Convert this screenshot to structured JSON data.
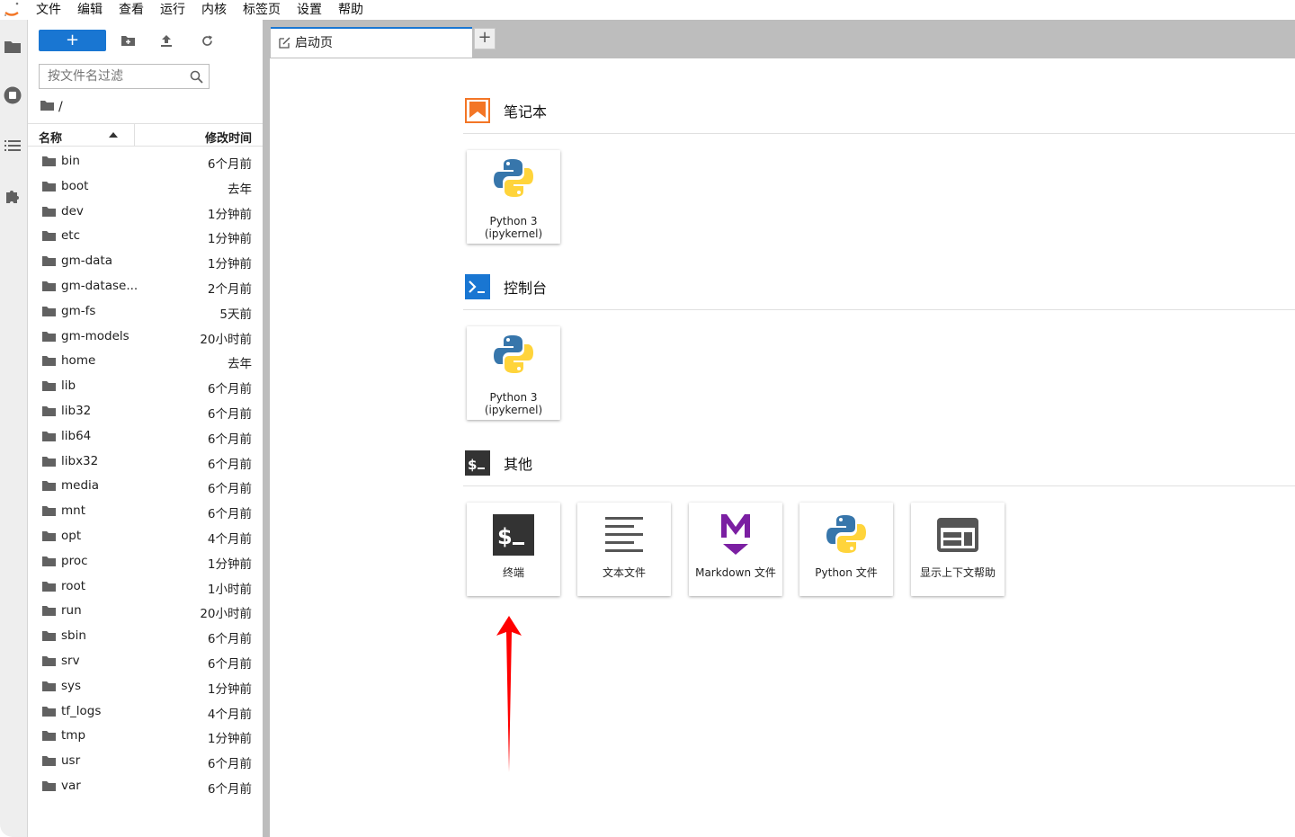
{
  "menubar": {
    "items": [
      "文件",
      "编辑",
      "查看",
      "运行",
      "内核",
      "标签页",
      "设置",
      "帮助"
    ]
  },
  "activity_bar": {
    "icons": [
      "folder-icon",
      "running-icon",
      "toc-icon",
      "extension-icon"
    ]
  },
  "file_browser": {
    "new_button_label": "+",
    "filter_placeholder": "按文件名过滤",
    "breadcrumb_separator": "/",
    "columns": {
      "name": "名称",
      "modified": "修改时间"
    },
    "files": [
      {
        "name": "bin",
        "modified": "6个月前"
      },
      {
        "name": "boot",
        "modified": "去年"
      },
      {
        "name": "dev",
        "modified": "1分钟前"
      },
      {
        "name": "etc",
        "modified": "1分钟前"
      },
      {
        "name": "gm-data",
        "modified": "1分钟前"
      },
      {
        "name": "gm-datase...",
        "modified": "2个月前"
      },
      {
        "name": "gm-fs",
        "modified": "5天前"
      },
      {
        "name": "gm-models",
        "modified": "20小时前"
      },
      {
        "name": "home",
        "modified": "去年"
      },
      {
        "name": "lib",
        "modified": "6个月前"
      },
      {
        "name": "lib32",
        "modified": "6个月前"
      },
      {
        "name": "lib64",
        "modified": "6个月前"
      },
      {
        "name": "libx32",
        "modified": "6个月前"
      },
      {
        "name": "media",
        "modified": "6个月前"
      },
      {
        "name": "mnt",
        "modified": "6个月前"
      },
      {
        "name": "opt",
        "modified": "4个月前"
      },
      {
        "name": "proc",
        "modified": "1分钟前"
      },
      {
        "name": "root",
        "modified": "1小时前"
      },
      {
        "name": "run",
        "modified": "20小时前"
      },
      {
        "name": "sbin",
        "modified": "6个月前"
      },
      {
        "name": "srv",
        "modified": "6个月前"
      },
      {
        "name": "sys",
        "modified": "1分钟前"
      },
      {
        "name": "tf_logs",
        "modified": "4个月前"
      },
      {
        "name": "tmp",
        "modified": "1分钟前"
      },
      {
        "name": "usr",
        "modified": "6个月前"
      },
      {
        "name": "var",
        "modified": "6个月前"
      }
    ]
  },
  "tabs": {
    "active_label": "启动页",
    "add_label": "+"
  },
  "launcher": {
    "notebook": {
      "title": "笔记本",
      "cards": [
        {
          "line1": "Python 3",
          "line2": "(ipykernel)"
        }
      ]
    },
    "console": {
      "title": "控制台",
      "icon_text": ">_",
      "cards": [
        {
          "line1": "Python 3",
          "line2": "(ipykernel)"
        }
      ]
    },
    "other": {
      "title": "其他",
      "icon_text": "$_",
      "cards": [
        {
          "label": "终端",
          "icon": "terminal-icon",
          "icon_text": "$_"
        },
        {
          "label": "文本文件",
          "icon": "text-file-icon"
        },
        {
          "label": "Markdown 文件",
          "icon": "markdown-icon",
          "icon_text": "M"
        },
        {
          "label": "Python 文件",
          "icon": "python-icon"
        },
        {
          "label": "显示上下文帮助",
          "icon": "context-help-icon"
        }
      ]
    }
  },
  "colors": {
    "accent": "#1976d2",
    "notebook_orange": "#f37626",
    "markdown_purple": "#7b1fa2",
    "annotation_arrow": "#ff0000"
  }
}
